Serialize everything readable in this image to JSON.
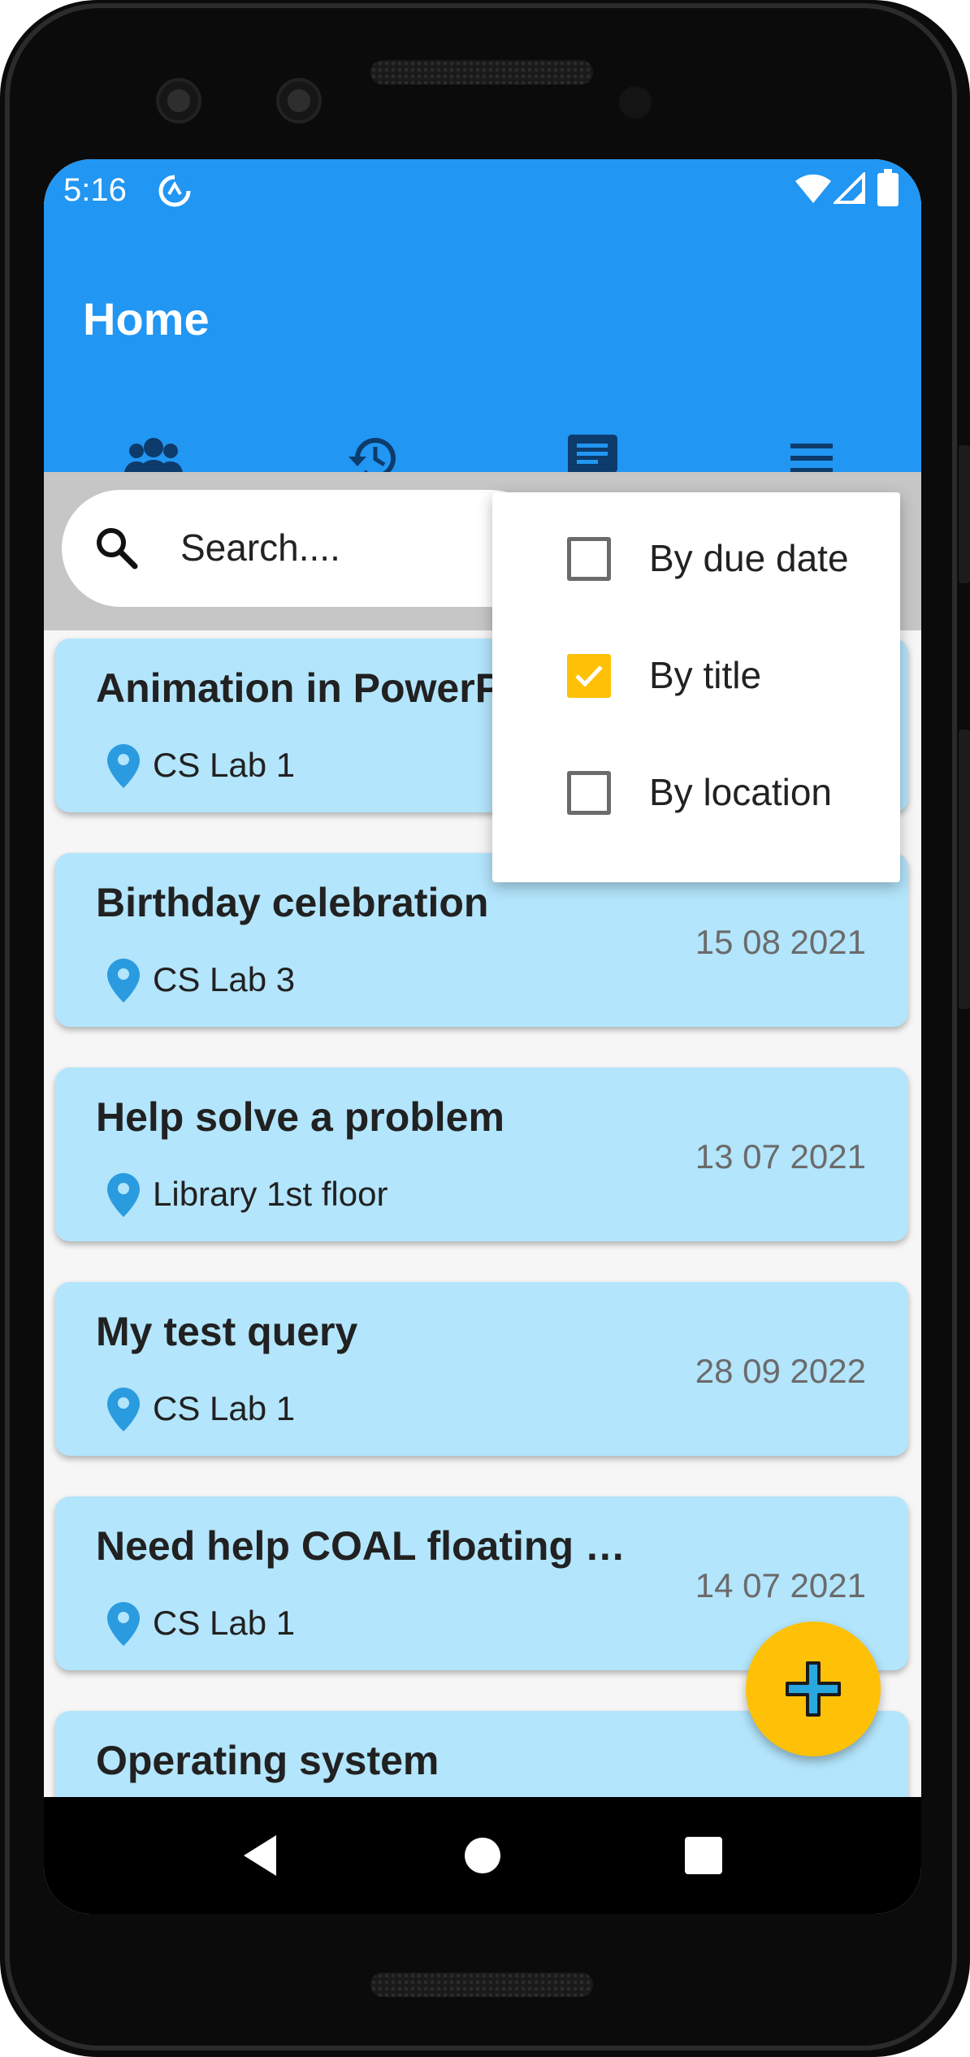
{
  "status_bar": {
    "time": "5:16",
    "icons": [
      "data-saver-icon",
      "wifi-icon",
      "signal-icon",
      "battery-icon"
    ]
  },
  "app_bar": {
    "title": "Home",
    "color": "#2196f3",
    "tabs": [
      {
        "icon": "group-icon",
        "selected": true
      },
      {
        "icon": "history-icon",
        "selected": false
      },
      {
        "icon": "chat-icon",
        "selected": false
      },
      {
        "icon": "menu-icon",
        "selected": false
      }
    ],
    "indicator_color": "#ffc107"
  },
  "search": {
    "placeholder": "Search...."
  },
  "sort_menu": {
    "items": [
      {
        "label": "By due date",
        "checked": false
      },
      {
        "label": "By title",
        "checked": true
      },
      {
        "label": "By location",
        "checked": false
      }
    ]
  },
  "cards": [
    {
      "title": "Animation in PowerP",
      "location": "CS Lab 1",
      "date": ""
    },
    {
      "title": "Birthday celebration",
      "location": "CS Lab 3",
      "date": "15 08 2021"
    },
    {
      "title": "Help solve a problem",
      "location": "Library 1st floor",
      "date": "13 07 2021"
    },
    {
      "title": "My test query",
      "location": "CS Lab 1",
      "date": "28 09 2022"
    },
    {
      "title": "Need help COAL floating …",
      "location": "CS Lab 1",
      "date": "14 07 2021"
    },
    {
      "title": "Operating system",
      "location": "",
      "date": ""
    }
  ],
  "card_color": "#b3e5fc",
  "fab": {
    "icon": "add-icon",
    "color": "#ffc107"
  },
  "nav_bar": {
    "buttons": [
      "back-icon",
      "home-icon",
      "recents-icon"
    ]
  }
}
